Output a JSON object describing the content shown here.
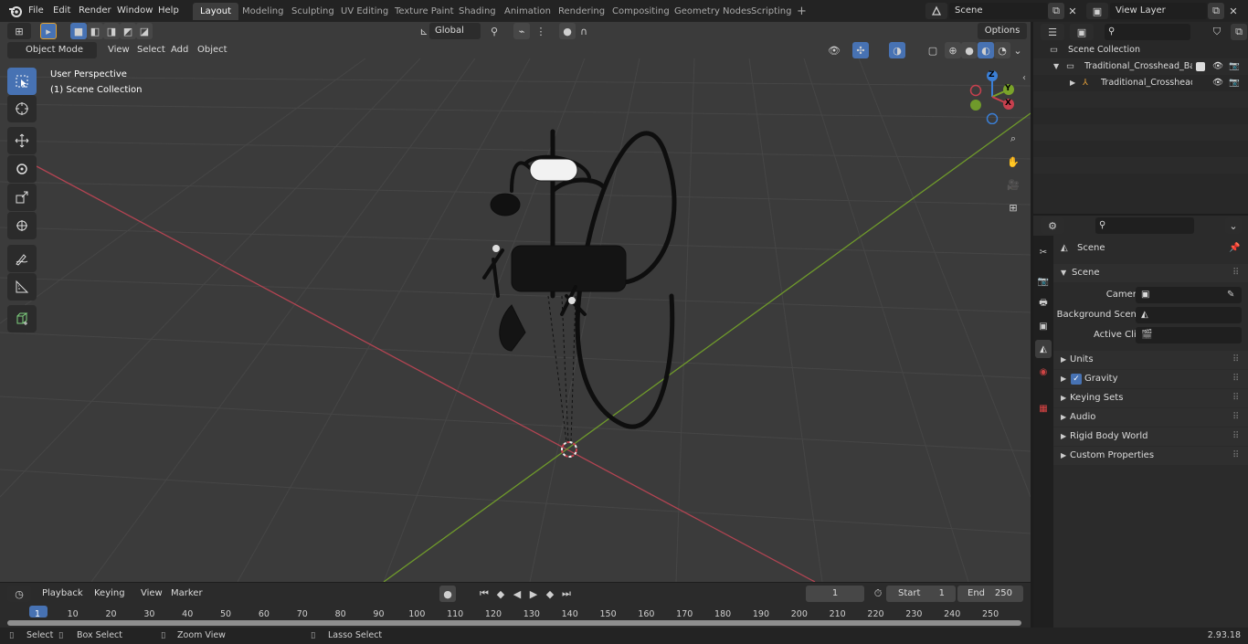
{
  "topbar": {
    "menu": [
      "File",
      "Edit",
      "Render",
      "Window",
      "Help"
    ],
    "workspaces": [
      {
        "label": "Layout",
        "active": true
      },
      {
        "label": "Modeling"
      },
      {
        "label": "Sculpting"
      },
      {
        "label": "UV Editing"
      },
      {
        "label": "Texture Paint"
      },
      {
        "label": "Shading"
      },
      {
        "label": "Animation"
      },
      {
        "label": "Rendering"
      },
      {
        "label": "Compositing"
      },
      {
        "label": "Geometry Nodes"
      },
      {
        "label": "Scripting"
      }
    ],
    "add_workspace": "+",
    "scene_value": "Scene",
    "view_layer_value": "View Layer"
  },
  "tool_header": {
    "transform_orientation": "Global",
    "options_label": "Options"
  },
  "viewport_header": {
    "mode": "Object Mode",
    "menus": [
      "View",
      "Select",
      "Add",
      "Object"
    ]
  },
  "viewport": {
    "overlay_line1": "User Perspective",
    "overlay_line2": "(1) Scene Collection",
    "gizmo_axes": {
      "x": "X",
      "y": "Y",
      "z": "Z"
    }
  },
  "outliner": {
    "root": "Scene Collection",
    "collection": "Traditional_Crosshead_Bath_S",
    "object": "Traditional_Crosshead_B"
  },
  "properties": {
    "context": "Scene",
    "panel": "Scene",
    "fields": [
      {
        "label": "Camera"
      },
      {
        "label": "Background Scene"
      },
      {
        "label": "Active Clip"
      }
    ],
    "subpanels": [
      "Units",
      "Gravity",
      "Keying Sets",
      "Audio",
      "Rigid Body World",
      "Custom Properties"
    ],
    "gravity_checked": true
  },
  "timeline": {
    "menus": [
      "Playback",
      "Keying",
      "View",
      "Marker"
    ],
    "current_frame": "1",
    "start_label": "Start",
    "start_value": "1",
    "end_label": "End",
    "end_value": "250",
    "ticks": [
      "1",
      "10",
      "20",
      "30",
      "40",
      "50",
      "60",
      "70",
      "80",
      "90",
      "100",
      "110",
      "120",
      "130",
      "140",
      "150",
      "160",
      "170",
      "180",
      "190",
      "200",
      "210",
      "220",
      "230",
      "240",
      "250"
    ]
  },
  "statusbar": {
    "select": "Select",
    "box_select": "Box Select",
    "zoom_view": "Zoom View",
    "lasso_select": "Lasso Select",
    "version": "2.93.18"
  },
  "colors": {
    "accent": "#4772b3",
    "x_axis": "#c8404e",
    "y_axis": "#7aa32a",
    "z_axis": "#3b7fd6"
  }
}
